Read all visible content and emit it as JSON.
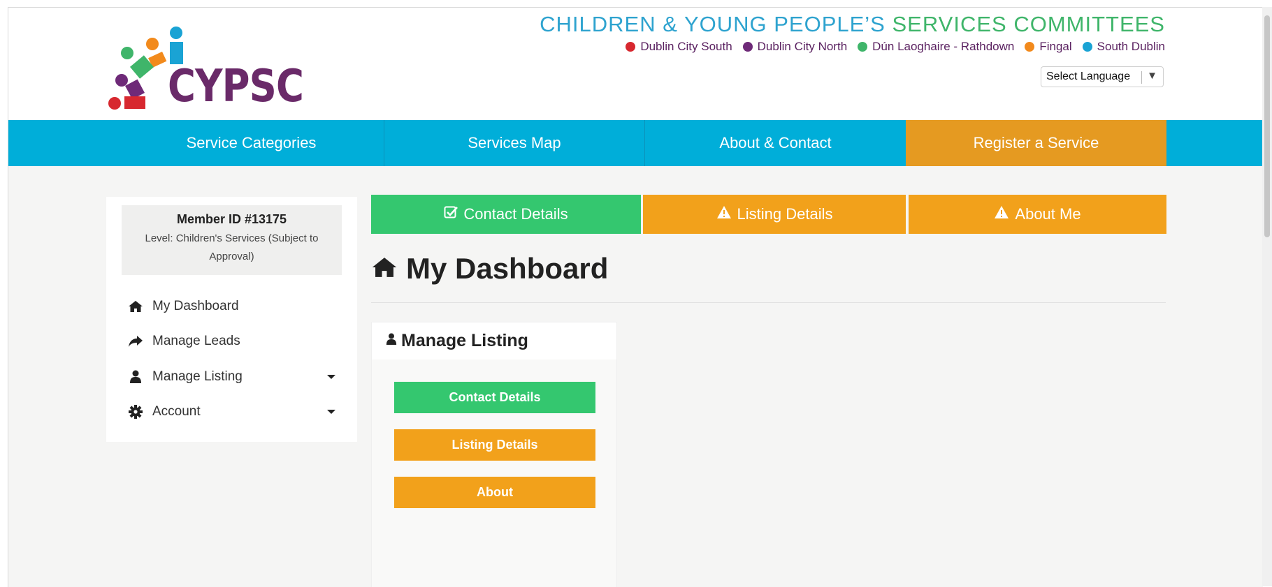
{
  "header": {
    "title_part1": "CHILDREN & YOUNG PEOPLE’S",
    "title_part2": "SERVICES COMMITTEES",
    "logo_text": "CYPSC",
    "areas": [
      {
        "label": "Dublin City South",
        "color": "#d7282f"
      },
      {
        "label": "Dublin City North",
        "color": "#6e2a78"
      },
      {
        "label": "Dún Laoghaire - Rathdown",
        "color": "#3fb56a"
      },
      {
        "label": "Fingal",
        "color": "#f28a1c"
      },
      {
        "label": "South Dublin",
        "color": "#1aa3d4"
      }
    ],
    "language_select": "Select Language"
  },
  "nav": {
    "items": [
      "Service Categories",
      "Services Map",
      "About & Contact",
      "Register a Service"
    ]
  },
  "sidebar": {
    "member_id": "Member ID #13175",
    "level": "Level: Children's Services (Subject to Approval)",
    "items": [
      {
        "label": "My Dashboard",
        "icon": "home-icon"
      },
      {
        "label": "Manage Leads",
        "icon": "share-icon"
      },
      {
        "label": "Manage Listing",
        "icon": "user-icon"
      },
      {
        "label": "Account",
        "icon": "gear-icon"
      }
    ]
  },
  "tabs": [
    {
      "label": "Contact Details",
      "icon": "check-square-icon",
      "color": "#34c76f"
    },
    {
      "label": "Listing Details",
      "icon": "warning-icon",
      "color": "#f2a11b"
    },
    {
      "label": "About Me",
      "icon": "warning-icon",
      "color": "#f2a11b"
    }
  ],
  "main": {
    "title": "My Dashboard",
    "panel_title": "Manage Listing",
    "buttons": [
      "Contact Details",
      "Listing Details",
      "About"
    ]
  },
  "colors": {
    "nav_blue": "#00aed9",
    "register_orange": "#e59a21",
    "green": "#34c76f",
    "orange": "#f2a11b",
    "brand_purple": "#6a2a69"
  }
}
